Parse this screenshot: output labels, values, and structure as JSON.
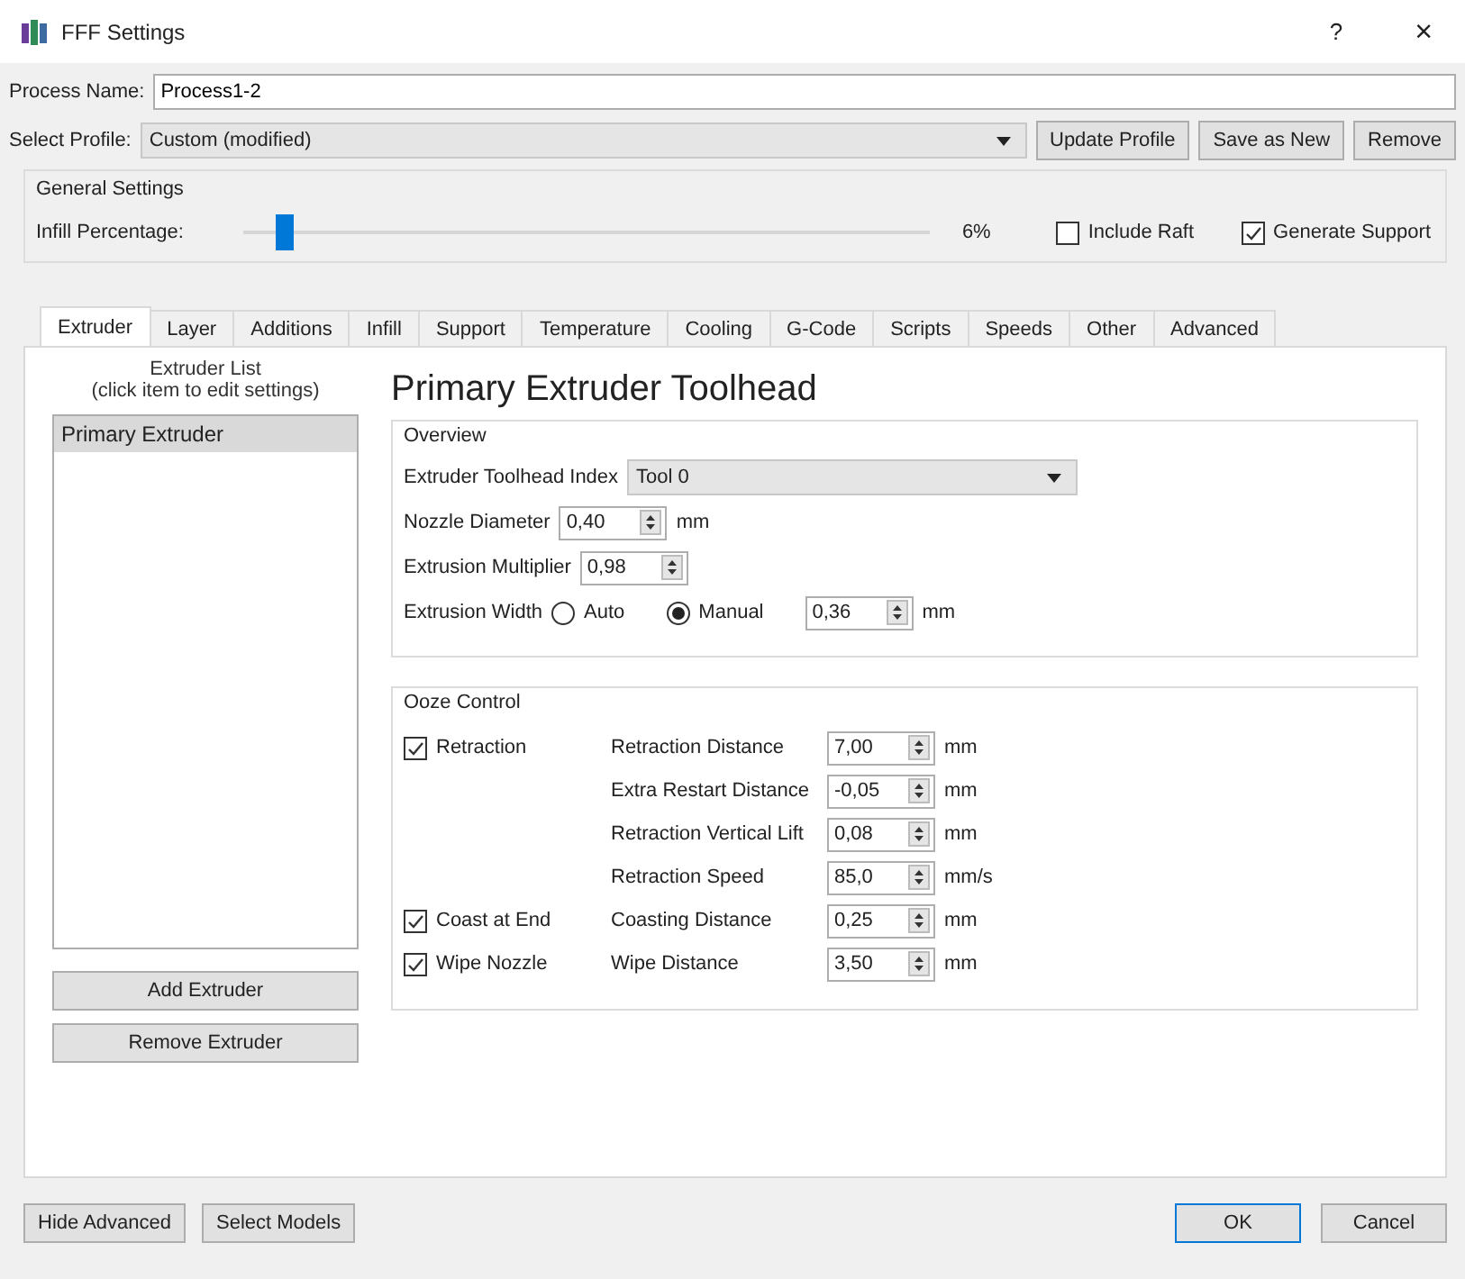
{
  "window": {
    "title": "FFF Settings",
    "help": "?",
    "close": "×"
  },
  "process_name": {
    "label": "Process Name:",
    "value": "Process1-2"
  },
  "profile": {
    "label": "Select Profile:",
    "value": "Custom (modified)",
    "buttons": [
      "Update Profile",
      "Save as New",
      "Remove"
    ]
  },
  "general_settings": {
    "title": "General Settings",
    "infill": {
      "label": "Infill Percentage:",
      "level": 0.06,
      "reading": "6%"
    },
    "options": [
      {
        "label": "Include Raft",
        "checked": false
      },
      {
        "label": "Generate Support",
        "checked": true
      }
    ]
  },
  "tabs": [
    {
      "label": "Extruder",
      "selected": true
    },
    {
      "label": "Layer",
      "selected": false
    },
    {
      "label": "Additions",
      "selected": false
    },
    {
      "label": "Infill",
      "selected": false
    },
    {
      "label": "Support",
      "selected": false
    },
    {
      "label": "Temperature",
      "selected": false
    },
    {
      "label": "Cooling",
      "selected": false
    },
    {
      "label": "G-Code",
      "selected": false
    },
    {
      "label": "Scripts",
      "selected": false
    },
    {
      "label": "Speeds",
      "selected": false
    },
    {
      "label": "Other",
      "selected": false
    },
    {
      "label": "Advanced",
      "selected": false
    }
  ],
  "extruder_list": {
    "heading": [
      "Extruder List",
      "(click item to edit settings)"
    ],
    "items": [
      {
        "label": "Primary Extruder",
        "selected": true
      }
    ],
    "buttons": [
      "Add Extruder",
      "Remove Extruder"
    ]
  },
  "heading": "Primary Extruder Toolhead",
  "overview": {
    "title": "Overview",
    "rows": [
      {
        "kind": "select",
        "label": "Extruder Toolhead Index",
        "value": "Tool 0"
      },
      {
        "kind": "spin",
        "label": "Nozzle Diameter",
        "value": "0,40",
        "unit": "mm"
      },
      {
        "kind": "spin",
        "label": "Extrusion Multiplier",
        "value": "0,98"
      },
      {
        "kind": "radio",
        "label": "Extrusion Width",
        "options": [
          {
            "label": "Auto",
            "selected": false
          },
          {
            "label": "Manual",
            "selected": true
          }
        ],
        "value": "0,36",
        "unit": "mm"
      }
    ]
  },
  "ooze_control": {
    "title": "Ooze Control",
    "rows": [
      {
        "checkbox": {
          "label": "Retraction",
          "checked": true
        },
        "label": "Retraction Distance",
        "value": "7,00",
        "unit": "mm"
      },
      {
        "label": "Extra Restart Distance",
        "value": "-0,05",
        "unit": "mm"
      },
      {
        "label": "Retraction Vertical Lift",
        "value": "0,08",
        "unit": "mm"
      },
      {
        "label": "Retraction Speed",
        "value": "85,0",
        "unit": "mm/s"
      },
      {
        "checkbox": {
          "label": "Coast at End",
          "checked": true
        },
        "label": "Coasting Distance",
        "value": "0,25",
        "unit": "mm"
      },
      {
        "checkbox": {
          "label": "Wipe Nozzle",
          "checked": true
        },
        "label": "Wipe Distance",
        "value": "3,50",
        "unit": "mm"
      }
    ]
  },
  "footer": {
    "left_buttons": [
      "Hide Advanced",
      "Select Models"
    ],
    "right_buttons": [
      {
        "label": "OK",
        "default": true
      },
      {
        "label": "Cancel",
        "default": false
      }
    ]
  }
}
